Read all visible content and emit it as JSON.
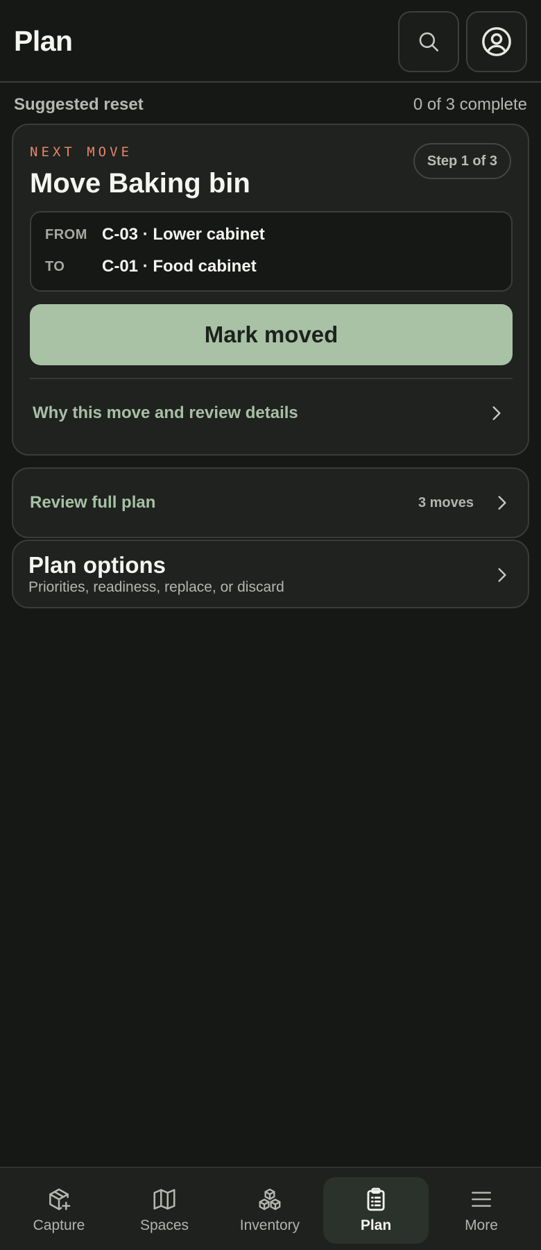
{
  "header": {
    "title": "Plan",
    "search_icon": "search-icon",
    "account_icon": "user-circle-icon"
  },
  "section": {
    "label": "Suggested reset",
    "progress": "0 of 3 complete"
  },
  "next_move": {
    "eyebrow": "NEXT MOVE",
    "step": "Step 1 of 3",
    "title": "Move Baking bin",
    "from_label": "FROM",
    "from_value": "C-03 · Lower cabinet",
    "to_label": "TO",
    "to_value": "C-01 · Food cabinet",
    "primary_action": "Mark moved",
    "details_link": "Why this move and review details"
  },
  "review": {
    "label": "Review full plan",
    "count": "3 moves"
  },
  "options": {
    "title": "Plan options",
    "subtitle": "Priorities, readiness, replace, or discard"
  },
  "nav": {
    "items": [
      {
        "label": "Capture",
        "icon": "box-plus-icon"
      },
      {
        "label": "Spaces",
        "icon": "map-icon"
      },
      {
        "label": "Inventory",
        "icon": "boxes-icon"
      },
      {
        "label": "Plan",
        "icon": "clipboard-list-icon",
        "active": true
      },
      {
        "label": "More",
        "icon": "menu-icon"
      }
    ]
  },
  "colors": {
    "background": "#161816",
    "card": "#1f221f",
    "accent_green": "#a9c2a6",
    "accent_orange": "#e8856a"
  }
}
